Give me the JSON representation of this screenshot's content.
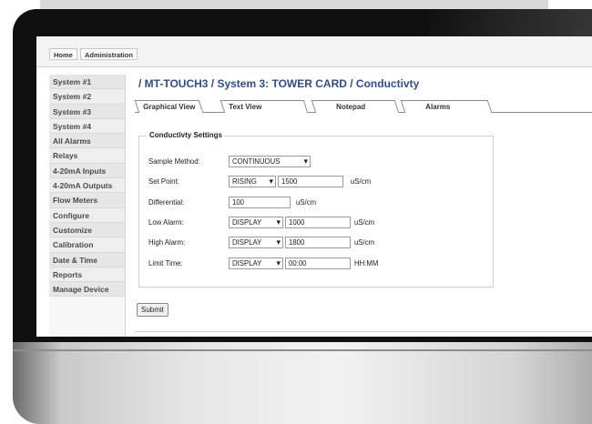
{
  "topbar": {
    "home": "Home",
    "admin": "Administration"
  },
  "sidebar": {
    "items": [
      {
        "label": "System #1"
      },
      {
        "label": "System #2"
      },
      {
        "label": "System #3"
      },
      {
        "label": "System #4"
      },
      {
        "label": "All Alarms"
      },
      {
        "label": "Relays"
      },
      {
        "label": "4-20mA Inputs"
      },
      {
        "label": "4-20mA Outputs"
      },
      {
        "label": "Flow Meters"
      },
      {
        "label": "Configure"
      },
      {
        "label": "Customize"
      },
      {
        "label": "Calibration"
      },
      {
        "label": "Date & Time"
      },
      {
        "label": "Reports"
      },
      {
        "label": "Manage Device"
      }
    ]
  },
  "main": {
    "title": "/ MT-TOUCH3 / System 3: TOWER CARD / Conductivty",
    "tabs": [
      {
        "label": "Graphical View"
      },
      {
        "label": "Text View"
      },
      {
        "label": "Notepad"
      },
      {
        "label": "Alarms"
      }
    ],
    "form": {
      "legend": "Conductivty Settings",
      "sample_method": {
        "label": "Sample Method:",
        "value": "CONTINUOUS"
      },
      "set_point": {
        "label": "Set Point:",
        "mode": "RISING",
        "value": "1500",
        "unit": "uS/cm"
      },
      "differential": {
        "label": "Differential:",
        "value": "100",
        "unit": "uS/cm"
      },
      "low_alarm": {
        "label": "Low Alarm:",
        "mode": "DISPLAY",
        "value": "1000",
        "unit": "uS/cm"
      },
      "high_alarm": {
        "label": "High Alarm:",
        "mode": "DISPLAY",
        "value": "1800",
        "unit": "uS/cm"
      },
      "limit_time": {
        "label": "Limit Time:",
        "mode": "DISPLAY",
        "value": "00:00",
        "unit": "HH:MM"
      }
    },
    "submit": "Submit"
  }
}
